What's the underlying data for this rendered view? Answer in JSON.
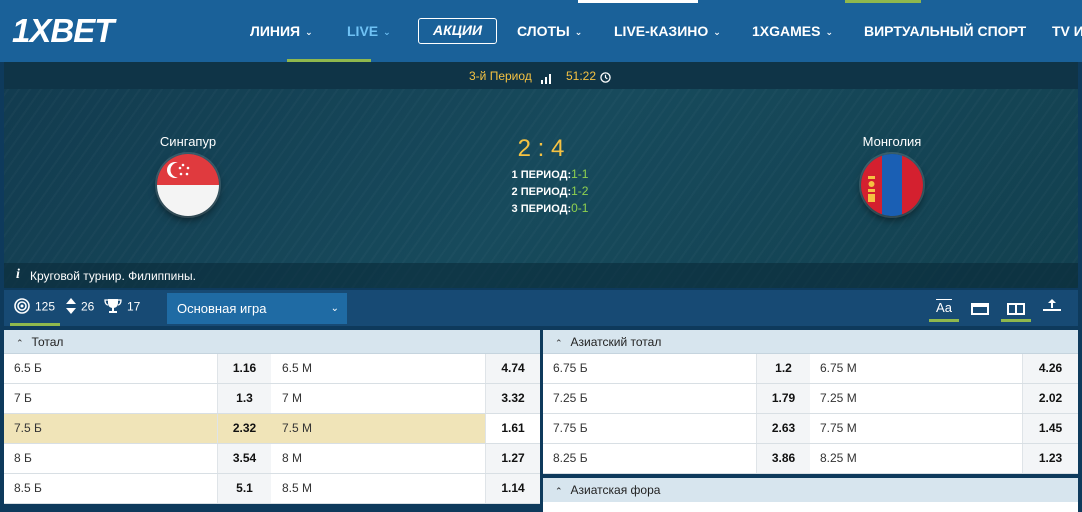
{
  "header": {
    "logo": "1XBET",
    "nav": [
      {
        "label": "ЛИНИЯ",
        "chevron": true
      },
      {
        "label": "LIVE",
        "chevron": true
      },
      {
        "label": "АКЦИИ",
        "chevron": false
      },
      {
        "label": "СЛОТЫ",
        "chevron": true
      },
      {
        "label": "LIVE-КАЗИНО",
        "chevron": true
      },
      {
        "label": "1XGAMES",
        "chevron": true
      },
      {
        "label": "ВИРТУАЛЬНЫЙ СПОРТ",
        "chevron": false
      },
      {
        "label": "TV И",
        "chevron": false
      }
    ],
    "chevron": "⌄"
  },
  "match": {
    "period": "3-й Период",
    "time": "51:22",
    "home": {
      "name": "Сингапур"
    },
    "away": {
      "name": "Монголия"
    },
    "score": "2 : 4",
    "periods": [
      {
        "label": "1 ПЕРИОД:",
        "value": "1-1"
      },
      {
        "label": "2 ПЕРИОД:",
        "value": "1-2"
      },
      {
        "label": "3 ПЕРИОД:",
        "value": "0-1"
      }
    ],
    "info_icon": "i",
    "tournament": "Круговой турнир. Филиппины."
  },
  "toolbar": {
    "count_all": "125",
    "count_updown": "26",
    "count_trophy": "17",
    "dropdown": "Основная игра",
    "view_text_label": "Aa"
  },
  "markets": {
    "total": {
      "title": "Тотал",
      "rows": [
        {
          "l1": "6.5 Б",
          "o1": "1.16",
          "l2": "6.5 М",
          "o2": "4.74"
        },
        {
          "l1": "7 Б",
          "o1": "1.3",
          "l2": "7 М",
          "o2": "3.32"
        },
        {
          "l1": "7.5 Б",
          "o1": "2.32",
          "l2": "7.5 М",
          "o2": "1.61"
        },
        {
          "l1": "8 Б",
          "o1": "3.54",
          "l2": "8 М",
          "o2": "1.27"
        },
        {
          "l1": "8.5 Б",
          "o1": "5.1",
          "l2": "8.5 М",
          "o2": "1.14"
        }
      ]
    },
    "asian_total": {
      "title": "Азиатский тотал",
      "rows": [
        {
          "l1": "6.75 Б",
          "o1": "1.2",
          "l2": "6.75 М",
          "o2": "4.26"
        },
        {
          "l1": "7.25 Б",
          "o1": "1.79",
          "l2": "7.25 М",
          "o2": "2.02"
        },
        {
          "l1": "7.75 Б",
          "o1": "2.63",
          "l2": "7.75 М",
          "o2": "1.45"
        },
        {
          "l1": "8.25 Б",
          "o1": "3.86",
          "l2": "8.25 М",
          "o2": "1.23"
        }
      ]
    },
    "asian_handicap": {
      "title": "Азиатская фора"
    }
  }
}
